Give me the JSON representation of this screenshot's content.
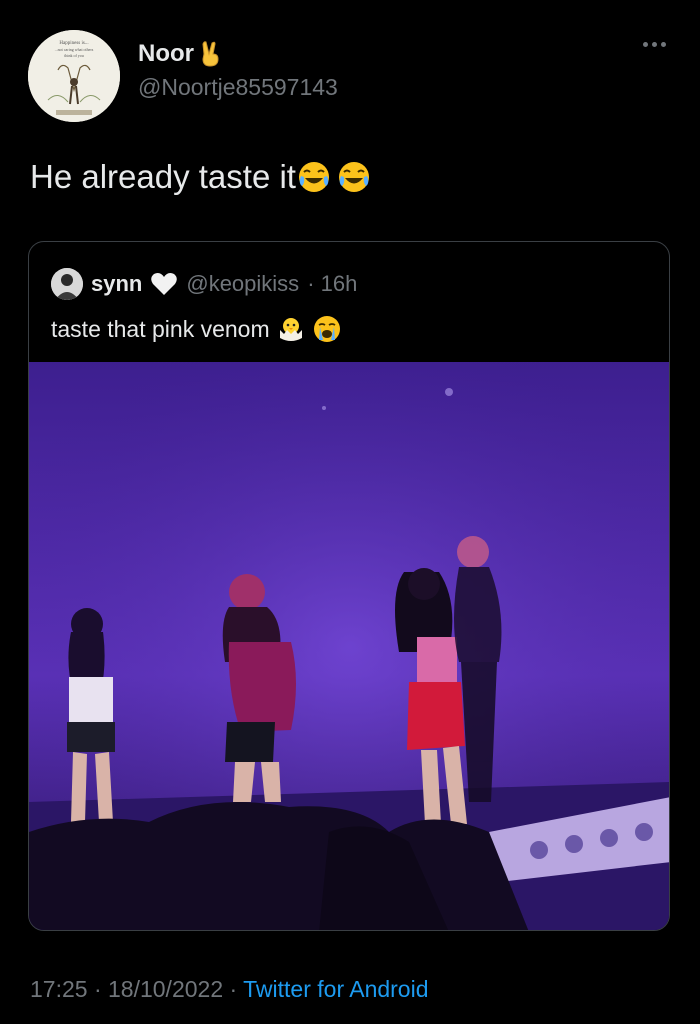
{
  "tweet": {
    "display_name": "Noor",
    "name_emoji_icon": "victory-hand-emoji",
    "handle": "@Noortje85597143",
    "avatar_text": [
      "Happiness is...",
      "...not caring what others",
      "think of you"
    ],
    "text": "He already taste it",
    "text_emoji_icons": [
      "joy-emoji",
      "joy-emoji"
    ],
    "timestamp": "17:25 · 18/10/2022 · ",
    "source": "Twitter for Android"
  },
  "quoted": {
    "display_name": "synn",
    "name_emoji_icon": "white-heart-emoji",
    "handle": "@keopikiss",
    "time": "· 16h",
    "text": "taste that pink venom",
    "text_emoji_icons": [
      "hatching-chick-emoji",
      "crying-emoji"
    ]
  },
  "colors": {
    "background": "#000000",
    "text": "#e7e9ea",
    "secondary": "#71767b",
    "link": "#1d9bf0",
    "border": "#3a3f44",
    "stage_purple": "#5a2db5"
  }
}
